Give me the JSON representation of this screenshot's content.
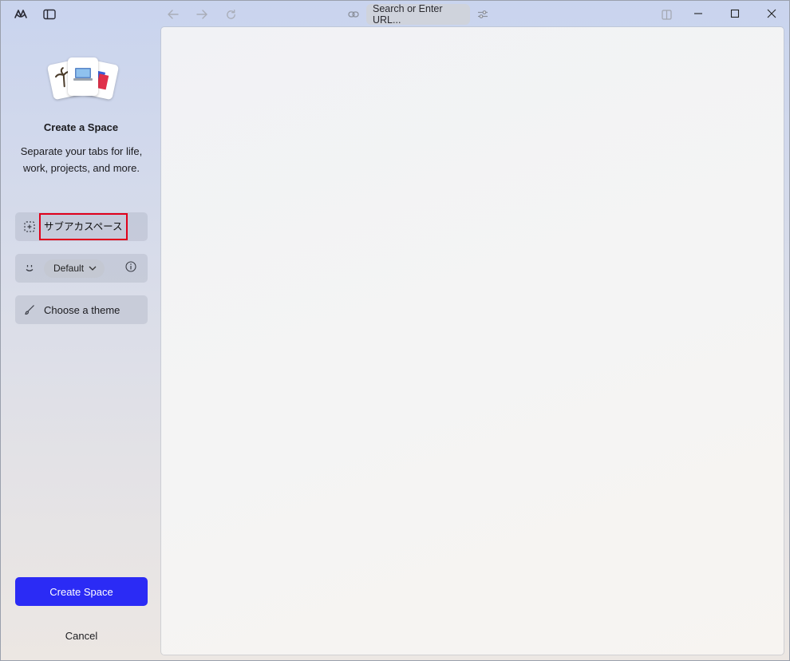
{
  "toolbar": {
    "url_placeholder": "Search or Enter URL..."
  },
  "sidebar": {
    "heading": "Create a Space",
    "subtext": "Separate your tabs for life, work, projects, and more.",
    "space_name": "サブアカスペース",
    "profile_label": "Default",
    "theme_label": "Choose a theme",
    "create_label": "Create Space",
    "cancel_label": "Cancel"
  },
  "icons": {
    "app": "arc-logo-icon",
    "sidebar_toggle": "sidebar-toggle-icon",
    "back": "arrow-left-icon",
    "forward": "arrow-right-icon",
    "reload": "reload-icon",
    "link": "link-icon",
    "site_controls": "sliders-icon",
    "split": "split-view-icon",
    "minimize": "minimize-icon",
    "maximize": "maximize-icon",
    "close": "close-icon",
    "space_icon_picker": "dashed-square-plus-icon",
    "profile": "smiley-icon",
    "info": "info-icon",
    "theme": "brush-icon"
  },
  "colors": {
    "primary_button": "#2b2bf5",
    "highlight_box": "#e0001b"
  }
}
